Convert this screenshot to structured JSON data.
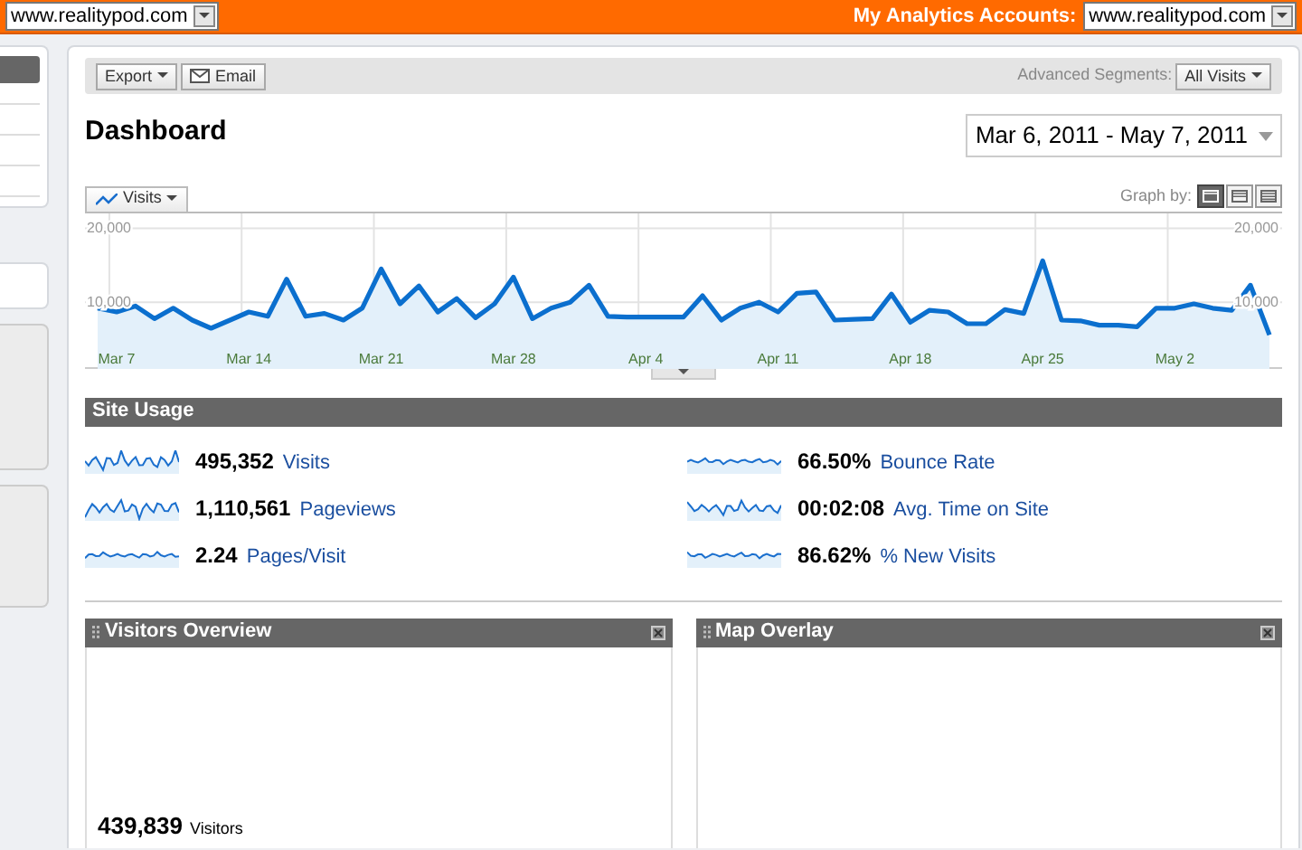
{
  "account_bar": {
    "site_select": "www.realitypod.com",
    "accounts_label": "My Analytics Accounts:",
    "accounts_select": "www.realitypod.com"
  },
  "toolbar": {
    "buttons": [
      {
        "label": "Export",
        "kind": "dropdown"
      },
      {
        "label": "Email",
        "kind": "email"
      }
    ],
    "segments_label": "Advanced Segments:",
    "segments_select": "All Visits"
  },
  "title": "Dashboard",
  "date_range": "Mar 6, 2011 - May 7, 2011",
  "graph": {
    "graph_by_label": "Graph by:",
    "graph_by_options": [
      {
        "kind": "day",
        "selected": true
      },
      {
        "kind": "week",
        "selected": false
      },
      {
        "kind": "month",
        "selected": false
      }
    ],
    "right_axis_labels": [
      "20,000",
      "10,000"
    ],
    "chart_data": {
      "type": "area",
      "grid": true,
      "categories": [
        null,
        "Mar 7",
        null,
        null,
        null,
        null,
        null,
        null,
        "Mar 14",
        null,
        null,
        null,
        null,
        null,
        null,
        "Mar 21",
        null,
        null,
        null,
        null,
        null,
        null,
        "Mar 28",
        null,
        null,
        null,
        null,
        null,
        null,
        "Apr 4",
        null,
        null,
        null,
        null,
        null,
        null,
        "Apr 11",
        null,
        null,
        null,
        null,
        null,
        null,
        "Apr 18",
        null,
        null,
        null,
        null,
        null,
        null,
        "Apr 25",
        null,
        null,
        null,
        null,
        null,
        null,
        "May 2",
        null,
        null,
        null,
        null,
        null
      ],
      "yticks": [
        {
          "value": 10000,
          "label": "10,000"
        },
        {
          "value": 20000,
          "label": "20,000"
        }
      ],
      "ylim": [
        1000,
        22000
      ],
      "series": [
        {
          "name": "Visits",
          "color": "#0b6fce",
          "values": [
            9200,
            8700,
            9500,
            7800,
            9200,
            7600,
            6500,
            7600,
            8700,
            8100,
            13100,
            8100,
            8500,
            7600,
            9200,
            14500,
            9800,
            12200,
            8700,
            10500,
            7900,
            9800,
            13400,
            7800,
            9200,
            10000,
            12300,
            8100,
            8000,
            8000,
            8000,
            8000,
            10900,
            7600,
            9200,
            10000,
            8700,
            11200,
            11400,
            7600,
            7700,
            7800,
            11100,
            7300,
            8900,
            8700,
            7100,
            7100,
            9000,
            8500,
            15600,
            7600,
            7500,
            6900,
            6900,
            6700,
            9200,
            9200,
            9800,
            9200,
            8900,
            12300,
            5600
          ]
        }
      ]
    }
  },
  "site_usage": {
    "title": "Site Usage",
    "metrics": [
      {
        "value": "495,352",
        "label": "Visits"
      },
      {
        "value": "1,110,561",
        "label": "Pageviews"
      },
      {
        "value": "2.24",
        "label": "Pages/Visit"
      },
      {
        "value": "66.50%",
        "label": "Bounce Rate"
      },
      {
        "value": "00:02:08",
        "label": "Avg. Time on Site"
      },
      {
        "value": "86.62%",
        "label": "% New Visits"
      }
    ]
  },
  "panels": [
    {
      "title": "Visitors Overview",
      "stat_value": "439,839",
      "stat_label": "Visitors"
    },
    {
      "title": "Map Overlay"
    }
  ]
}
